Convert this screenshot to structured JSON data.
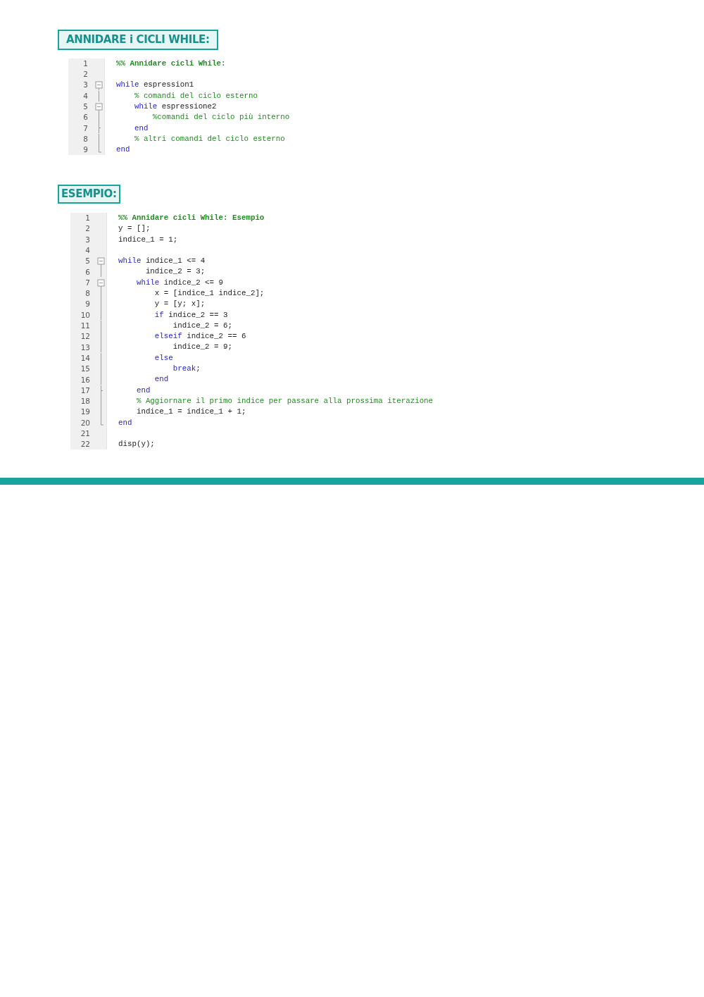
{
  "sections": [
    {
      "heading": "ANNIDARE i CICLI WHILE:",
      "code": [
        {
          "number": "1",
          "kind": "plain",
          "tokens": [
            {
              "kind": "section",
              "text": "%% Annidare cicli While:"
            }
          ]
        },
        {
          "number": "2",
          "kind": "plain"
        },
        {
          "number": "3",
          "kind": "fold_start",
          "tokens": [
            {
              "kind": "keyword",
              "text": "while"
            },
            {
              "kind": "plain",
              "text": " espression1"
            }
          ]
        },
        {
          "number": "4",
          "kind": "fold_line",
          "tokens": [
            {
              "kind": "comment",
              "text": "    % comandi del ciclo esterno"
            }
          ]
        },
        {
          "number": "5",
          "kind": "fold_start",
          "tokens": [
            {
              "kind": "keyword",
              "text": "    while"
            },
            {
              "kind": "plain",
              "text": " espressione2"
            }
          ]
        },
        {
          "number": "6",
          "kind": "fold_line",
          "tokens": [
            {
              "kind": "comment",
              "text": "        %comandi del ciclo più interno"
            }
          ]
        },
        {
          "number": "7",
          "kind": "fold_tick",
          "tokens": [
            {
              "kind": "keyword",
              "text": "    end"
            }
          ]
        },
        {
          "number": "8",
          "kind": "fold_line",
          "tokens": [
            {
              "kind": "comment",
              "text": "    % altri comandi del ciclo esterno"
            }
          ]
        },
        {
          "number": "9",
          "kind": "fold_end",
          "tokens": [
            {
              "kind": "keyword",
              "text": "end"
            }
          ]
        }
      ]
    },
    {
      "heading": "ESEMPIO:",
      "code": [
        {
          "number": "1",
          "kind": "plain",
          "tokens": [
            {
              "kind": "section",
              "text": "%% Annidare cicli While: Esempio"
            }
          ]
        },
        {
          "number": "2",
          "kind": "plain",
          "tokens": [
            {
              "kind": "plain",
              "text": "y = [];"
            }
          ]
        },
        {
          "number": "3",
          "kind": "plain",
          "tokens": [
            {
              "kind": "plain",
              "text": "indice_1 = 1;"
            }
          ]
        },
        {
          "number": "4",
          "kind": "plain"
        },
        {
          "number": "5",
          "kind": "fold_start",
          "tokens": [
            {
              "kind": "keyword",
              "text": "while"
            },
            {
              "kind": "plain",
              "text": " indice_1 <= 4"
            }
          ]
        },
        {
          "number": "6",
          "kind": "fold_line",
          "tokens": [
            {
              "kind": "plain",
              "text": "      indice_2 = 3;"
            }
          ]
        },
        {
          "number": "7",
          "kind": "fold_start",
          "tokens": [
            {
              "kind": "keyword",
              "text": "    while"
            },
            {
              "kind": "plain",
              "text": " indice_2 <= 9"
            }
          ]
        },
        {
          "number": "8",
          "kind": "fold_line",
          "tokens": [
            {
              "kind": "plain",
              "text": "        x = [indice_1 indice_2];"
            }
          ]
        },
        {
          "number": "9",
          "kind": "fold_line",
          "tokens": [
            {
              "kind": "plain",
              "text": "        y = [y; x];"
            }
          ]
        },
        {
          "number": "10",
          "kind": "fold_line",
          "tokens": [
            {
              "kind": "keyword",
              "text": "        if"
            },
            {
              "kind": "plain",
              "text": " indice_2 == 3"
            }
          ]
        },
        {
          "number": "11",
          "kind": "fold_line",
          "tokens": [
            {
              "kind": "plain",
              "text": "            indice_2 = 6;"
            }
          ]
        },
        {
          "number": "12",
          "kind": "fold_line",
          "tokens": [
            {
              "kind": "keyword",
              "text": "        elseif"
            },
            {
              "kind": "plain",
              "text": " indice_2 == 6"
            }
          ]
        },
        {
          "number": "13",
          "kind": "fold_line",
          "tokens": [
            {
              "kind": "plain",
              "text": "            indice_2 = 9;"
            }
          ]
        },
        {
          "number": "14",
          "kind": "fold_line",
          "tokens": [
            {
              "kind": "keyword",
              "text": "        else"
            }
          ]
        },
        {
          "number": "15",
          "kind": "fold_line",
          "tokens": [
            {
              "kind": "keyword",
              "text": "            break"
            },
            {
              "kind": "plain",
              "text": ";"
            }
          ]
        },
        {
          "number": "16",
          "kind": "fold_line",
          "tokens": [
            {
              "kind": "keyword",
              "text": "        end"
            }
          ]
        },
        {
          "number": "17",
          "kind": "fold_tick",
          "tokens": [
            {
              "kind": "keyword",
              "text": "    end"
            }
          ]
        },
        {
          "number": "18",
          "kind": "fold_line",
          "tokens": [
            {
              "kind": "comment",
              "text": "    % Aggiornare il primo indice per passare alla prossima iterazione"
            }
          ]
        },
        {
          "number": "19",
          "kind": "fold_line",
          "tokens": [
            {
              "kind": "plain",
              "text": "    indice_1 = indice_1 + 1;"
            }
          ]
        },
        {
          "number": "20",
          "kind": "fold_end",
          "tokens": [
            {
              "kind": "keyword",
              "text": "end"
            }
          ]
        },
        {
          "number": "21",
          "kind": "plain"
        },
        {
          "number": "22",
          "kind": "plain",
          "tokens": [
            {
              "kind": "plain",
              "text": "disp(y);"
            }
          ]
        }
      ]
    }
  ]
}
